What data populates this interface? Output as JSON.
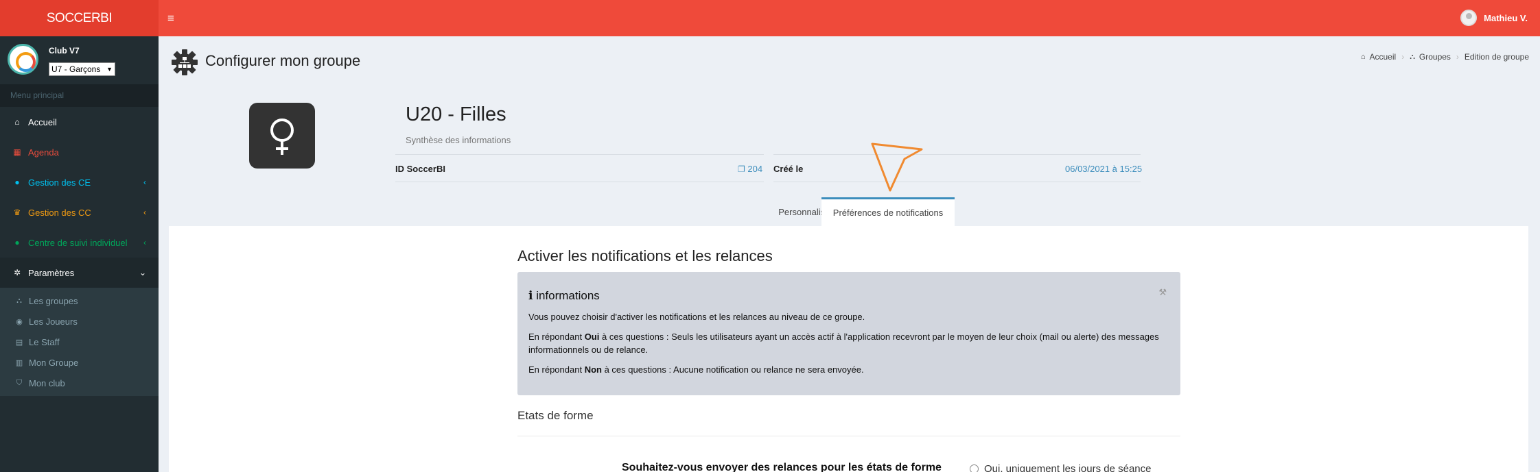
{
  "topbar": {
    "logo": "SOCCERBI",
    "user_name": "Mathieu V."
  },
  "sidebar": {
    "club_name": "Club V7",
    "club_select": "U7 - Garçons",
    "menu_header": "Menu principal",
    "items": [
      {
        "label": "Accueil",
        "icon": "home-icon"
      },
      {
        "label": "Agenda",
        "icon": "calendar-icon"
      },
      {
        "label": "Gestion des CE",
        "icon": "soccer-ball-icon"
      },
      {
        "label": "Gestion des CC",
        "icon": "trophy-icon"
      },
      {
        "label": "Centre de suivi individuel",
        "icon": "soccer-ball-icon"
      },
      {
        "label": "Paramètres",
        "icon": "gear-icon"
      }
    ],
    "subitems": [
      {
        "label": "Les groupes",
        "icon": "sitemap-icon"
      },
      {
        "label": "Les Joueurs",
        "icon": "user-circle-icon"
      },
      {
        "label": "Le Staff",
        "icon": "id-card-icon"
      },
      {
        "label": "Mon Groupe",
        "icon": "chart-icon"
      },
      {
        "label": "Mon club",
        "icon": "shield-icon"
      }
    ]
  },
  "header": {
    "title": "Configurer mon groupe",
    "breadcrumb": [
      "Accueil",
      "Groupes",
      "Edition de groupe"
    ]
  },
  "group": {
    "name": "U20 - Filles",
    "subtitle": "Synthèse des informations",
    "id_label": "ID SoccerBI",
    "id_value": "204",
    "created_label": "Créé le",
    "created_value": "06/03/2021 à 15:25"
  },
  "tabs": [
    {
      "label": "Personnaliser",
      "active": false
    },
    {
      "label": "Préférences de notifications",
      "active": true
    }
  ],
  "main": {
    "section_title": "Activer les notifications et les relances",
    "info_title": "informations",
    "info_p1": "Vous pouvez choisir d'activer les notifications et les relances au niveau de ce groupe.",
    "info_p2_pre": "En répondant ",
    "info_p2_bold": "Oui",
    "info_p2_post": " à ces questions : Seuls les utilisateurs ayant un accès actif à l'application recevront par le moyen de leur choix (mail ou alerte) des messages informationnels ou de relance.",
    "info_p3_pre": "En répondant ",
    "info_p3_bold": "Non",
    "info_p3_post": " à ces questions : Aucune notification ou relance ne sera envoyée.",
    "etats_title": "Etats de forme",
    "question": "Souhaitez-vous envoyer des relances pour les états de forme",
    "radio_option": "Oui, uniquement les jours de séance"
  },
  "colors": {
    "topbar": "#ef4a3a",
    "sidebar": "#222d32",
    "accent": "#3c8dbc"
  }
}
